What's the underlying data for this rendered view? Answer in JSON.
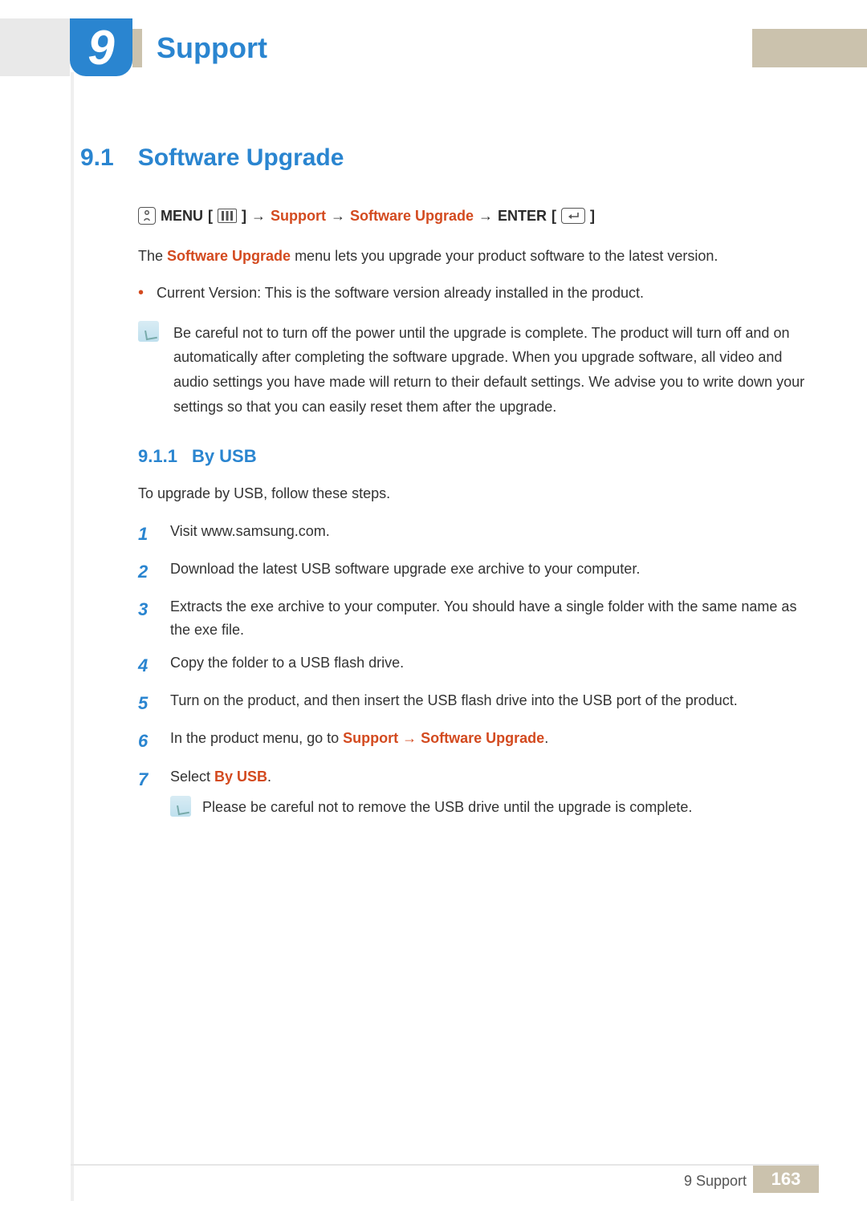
{
  "header": {
    "chapter_number": "9",
    "chapter_title": "Support"
  },
  "section": {
    "number": "9.1",
    "title": "Software Upgrade"
  },
  "nav": {
    "menu_label": "MENU",
    "bracket_open": "[",
    "bracket_close": "]",
    "arrow": "→",
    "support": "Support",
    "software_upgrade": "Software Upgrade",
    "enter_label": "ENTER"
  },
  "intro": {
    "prefix": "The ",
    "highlight": "Software Upgrade",
    "suffix": " menu lets you upgrade your product software to the latest version."
  },
  "bullet": {
    "label": "Current Version",
    "text": ": This is the software version already installed in the product."
  },
  "note1": "Be careful not to turn off the power until the upgrade is complete. The product will turn off and on automatically after completing the software upgrade. When you upgrade software, all video and audio settings you have made will return to their default settings. We advise you to write down your settings so that you can easily reset them after the upgrade.",
  "subsection": {
    "number": "9.1.1",
    "title": "By USB"
  },
  "usb_intro": "To upgrade by USB, follow these steps.",
  "steps": [
    {
      "n": "1",
      "text": "Visit www.samsung.com."
    },
    {
      "n": "2",
      "text": "Download the latest USB software upgrade exe archive to your computer."
    },
    {
      "n": "3",
      "text": "Extracts the exe archive to your computer. You should have a single folder with the same name as the exe file."
    },
    {
      "n": "4",
      "text": "Copy the folder to a USB flash drive."
    },
    {
      "n": "5",
      "text": "Turn on the product, and then insert the USB flash drive into the USB port of the product."
    }
  ],
  "step6": {
    "n": "6",
    "prefix": "In the product menu, go to ",
    "support": "Support",
    "arrow": " → ",
    "software_upgrade": "Software Upgrade",
    "suffix": "."
  },
  "step7": {
    "n": "7",
    "prefix": "Select ",
    "by_usb": "By USB",
    "suffix": ".",
    "note": "Please be careful not to remove the USB drive until the upgrade is complete."
  },
  "footer": {
    "label": "9 Support",
    "page": "163"
  }
}
